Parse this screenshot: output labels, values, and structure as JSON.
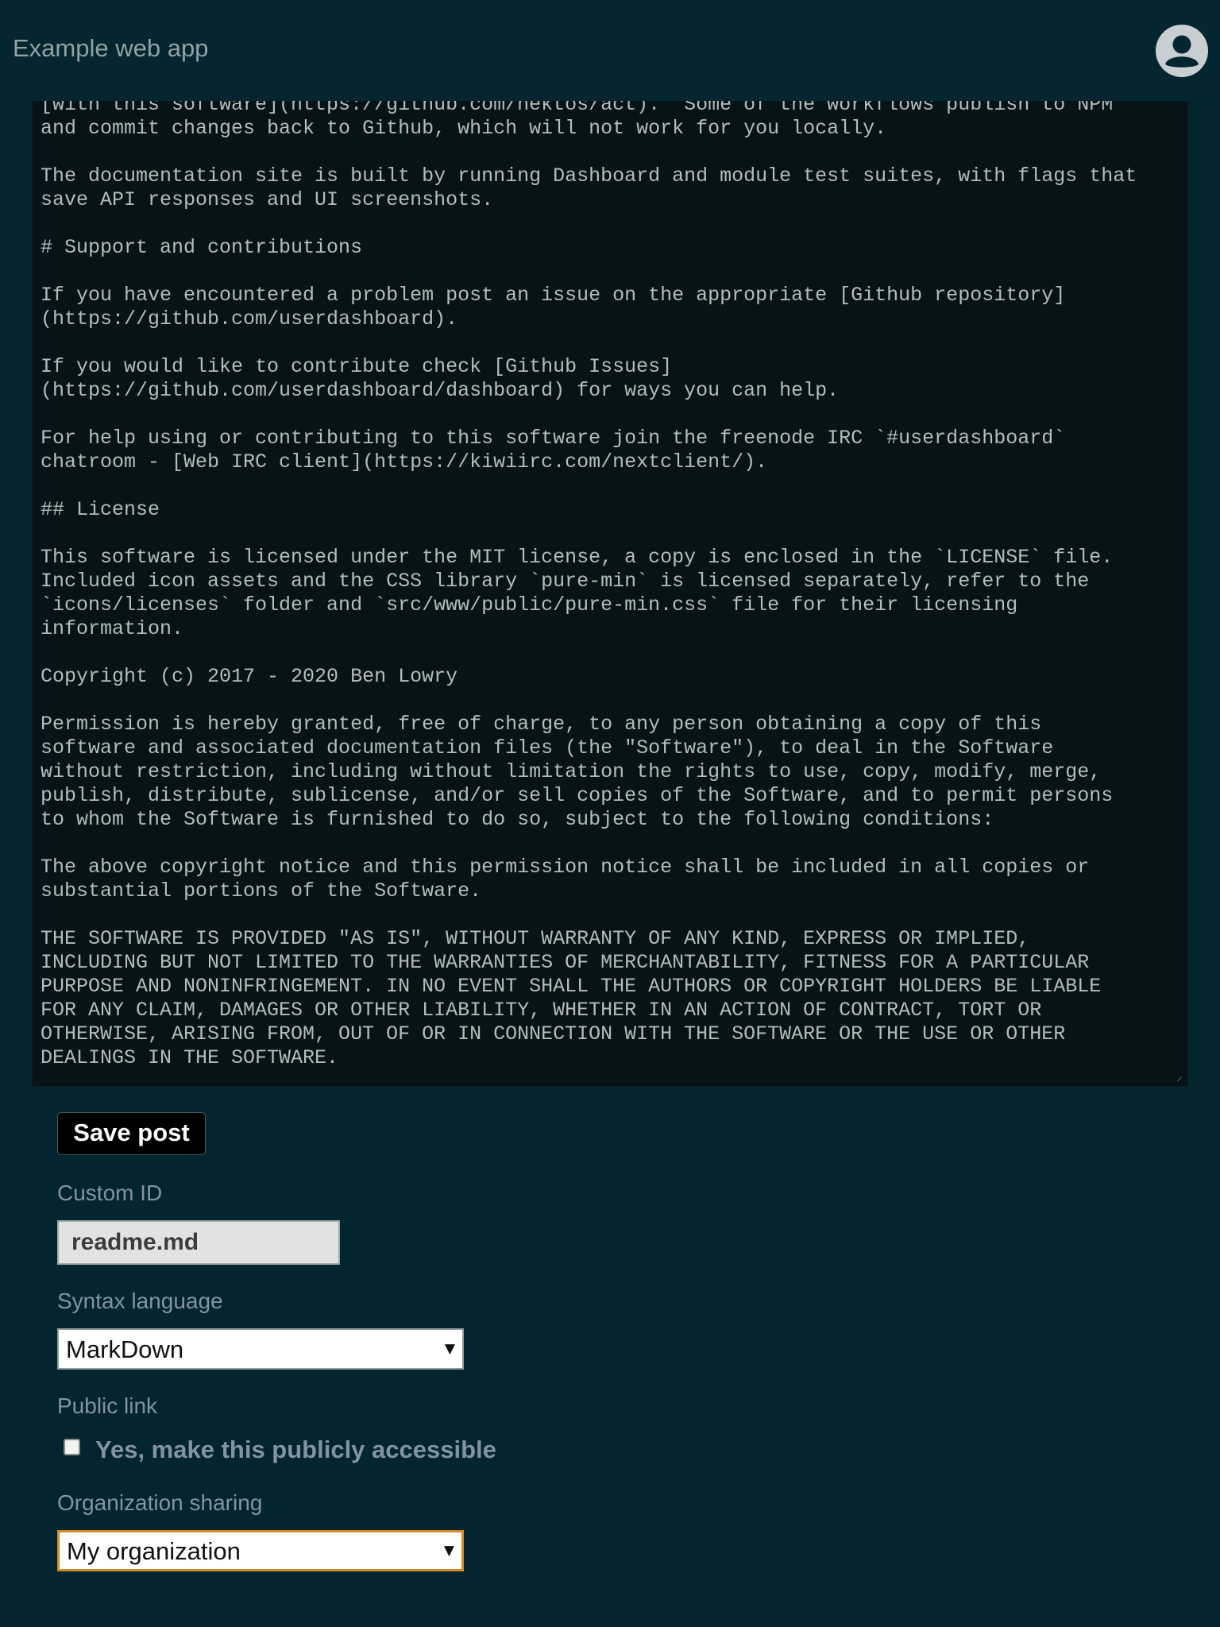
{
  "header": {
    "app_title": "Example web app",
    "account_icon": "user-account-icon"
  },
  "editor": {
    "content": "[with this software](https://github.com/nektos/act).  Some of the workflows publish to NPM\nand commit changes back to Github, which will not work for you locally.\n\nThe documentation site is built by running Dashboard and module test suites, with flags that\nsave API responses and UI screenshots.\n\n# Support and contributions\n\nIf you have encountered a problem post an issue on the appropriate [Github repository]\n(https://github.com/userdashboard).\n\nIf you would like to contribute check [Github Issues]\n(https://github.com/userdashboard/dashboard) for ways you can help.\n\nFor help using or contributing to this software join the freenode IRC `#userdashboard`\nchatroom - [Web IRC client](https://kiwiirc.com/nextclient/).\n\n## License\n\nThis software is licensed under the MIT license, a copy is enclosed in the `LICENSE` file.\nIncluded icon assets and the CSS library `pure-min` is licensed separately, refer to the\n`icons/licenses` folder and `src/www/public/pure-min.css` file for their licensing\ninformation.\n\nCopyright (c) 2017 - 2020 Ben Lowry\n\nPermission is hereby granted, free of charge, to any person obtaining a copy of this\nsoftware and associated documentation files (the \"Software\"), to deal in the Software\nwithout restriction, including without limitation the rights to use, copy, modify, merge,\npublish, distribute, sublicense, and/or sell copies of the Software, and to permit persons\nto whom the Software is furnished to do so, subject to the following conditions:\n\nThe above copyright notice and this permission notice shall be included in all copies or\nsubstantial portions of the Software.\n\nTHE SOFTWARE IS PROVIDED \"AS IS\", WITHOUT WARRANTY OF ANY KIND, EXPRESS OR IMPLIED,\nINCLUDING BUT NOT LIMITED TO THE WARRANTIES OF MERCHANTABILITY, FITNESS FOR A PARTICULAR\nPURPOSE AND NONINFRINGEMENT. IN NO EVENT SHALL THE AUTHORS OR COPYRIGHT HOLDERS BE LIABLE\nFOR ANY CLAIM, DAMAGES OR OTHER LIABILITY, WHETHER IN AN ACTION OF CONTRACT, TORT OR\nOTHERWISE, ARISING FROM, OUT OF OR IN CONNECTION WITH THE SOFTWARE OR THE USE OR OTHER\nDEALINGS IN THE SOFTWARE.",
    "resize_icon": "resize-grip-icon"
  },
  "form": {
    "save_label": "Save post",
    "custom_id": {
      "label": "Custom ID",
      "value": "readme.md"
    },
    "syntax": {
      "label": "Syntax language",
      "selected": "MarkDown"
    },
    "public_link": {
      "label": "Public link",
      "checkbox_label": "Yes, make this publicly accessible",
      "checked": false
    },
    "organization": {
      "label": "Organization sharing",
      "selected": "My organization"
    },
    "dropdown_icon": "dropdown-arrow-icon"
  },
  "colors": {
    "background": "#022530",
    "editor_background": "#061317",
    "editor_text": "#b6bcbc",
    "label_text": "#8394a0",
    "focus_border": "#d28b28"
  }
}
